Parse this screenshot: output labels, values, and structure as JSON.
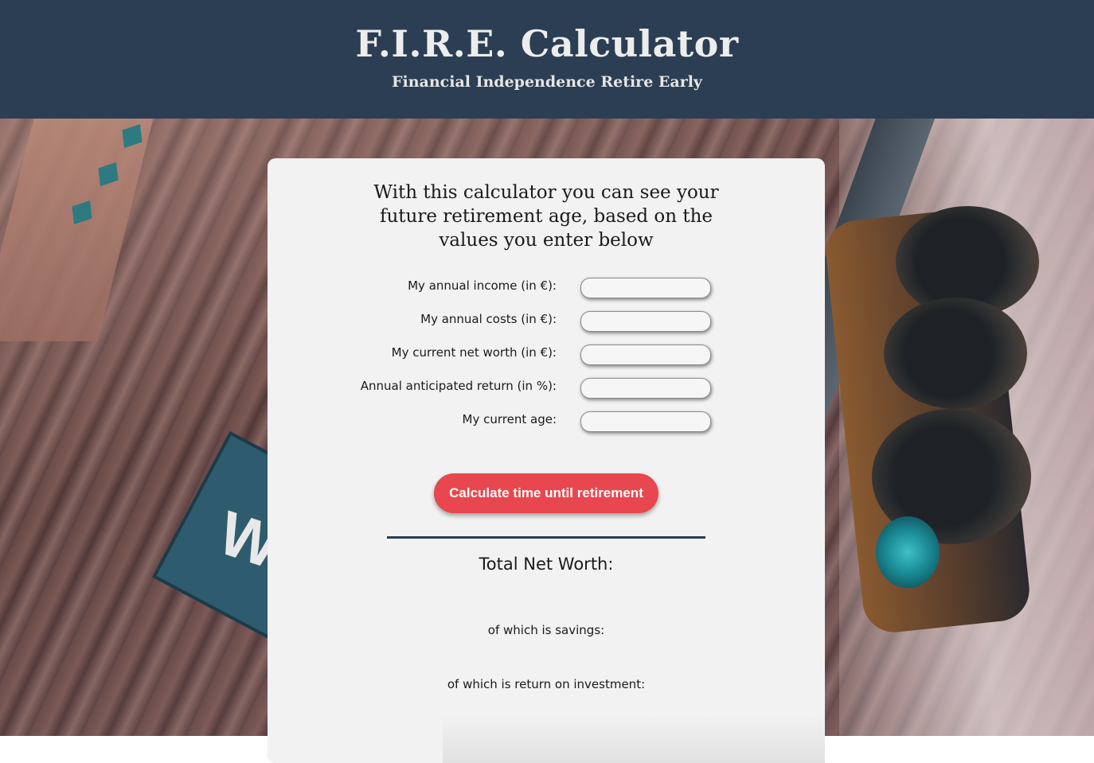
{
  "header": {
    "title": "F.I.R.E. Calculator",
    "subtitle": "Financial Independence Retire Early"
  },
  "form": {
    "intro": "With this calculator you can see your future retirement age, based on the values you enter below",
    "fields": [
      {
        "label": "My annual income (in €):",
        "value": ""
      },
      {
        "label": "My annual costs (in €):",
        "value": ""
      },
      {
        "label": "My current net worth (in €):",
        "value": ""
      },
      {
        "label": "Annual anticipated return (in %):",
        "value": ""
      },
      {
        "label": "My current age:",
        "value": ""
      }
    ],
    "button_label": "Calculate time until retirement"
  },
  "results": {
    "total_label": "Total Net Worth:",
    "savings_label": "of which is savings:",
    "roi_label": "of which is return on investment:"
  },
  "colors": {
    "header_bg": "#2b3e54",
    "button_bg": "#e8474f",
    "card_bg": "#f2f2f2"
  }
}
